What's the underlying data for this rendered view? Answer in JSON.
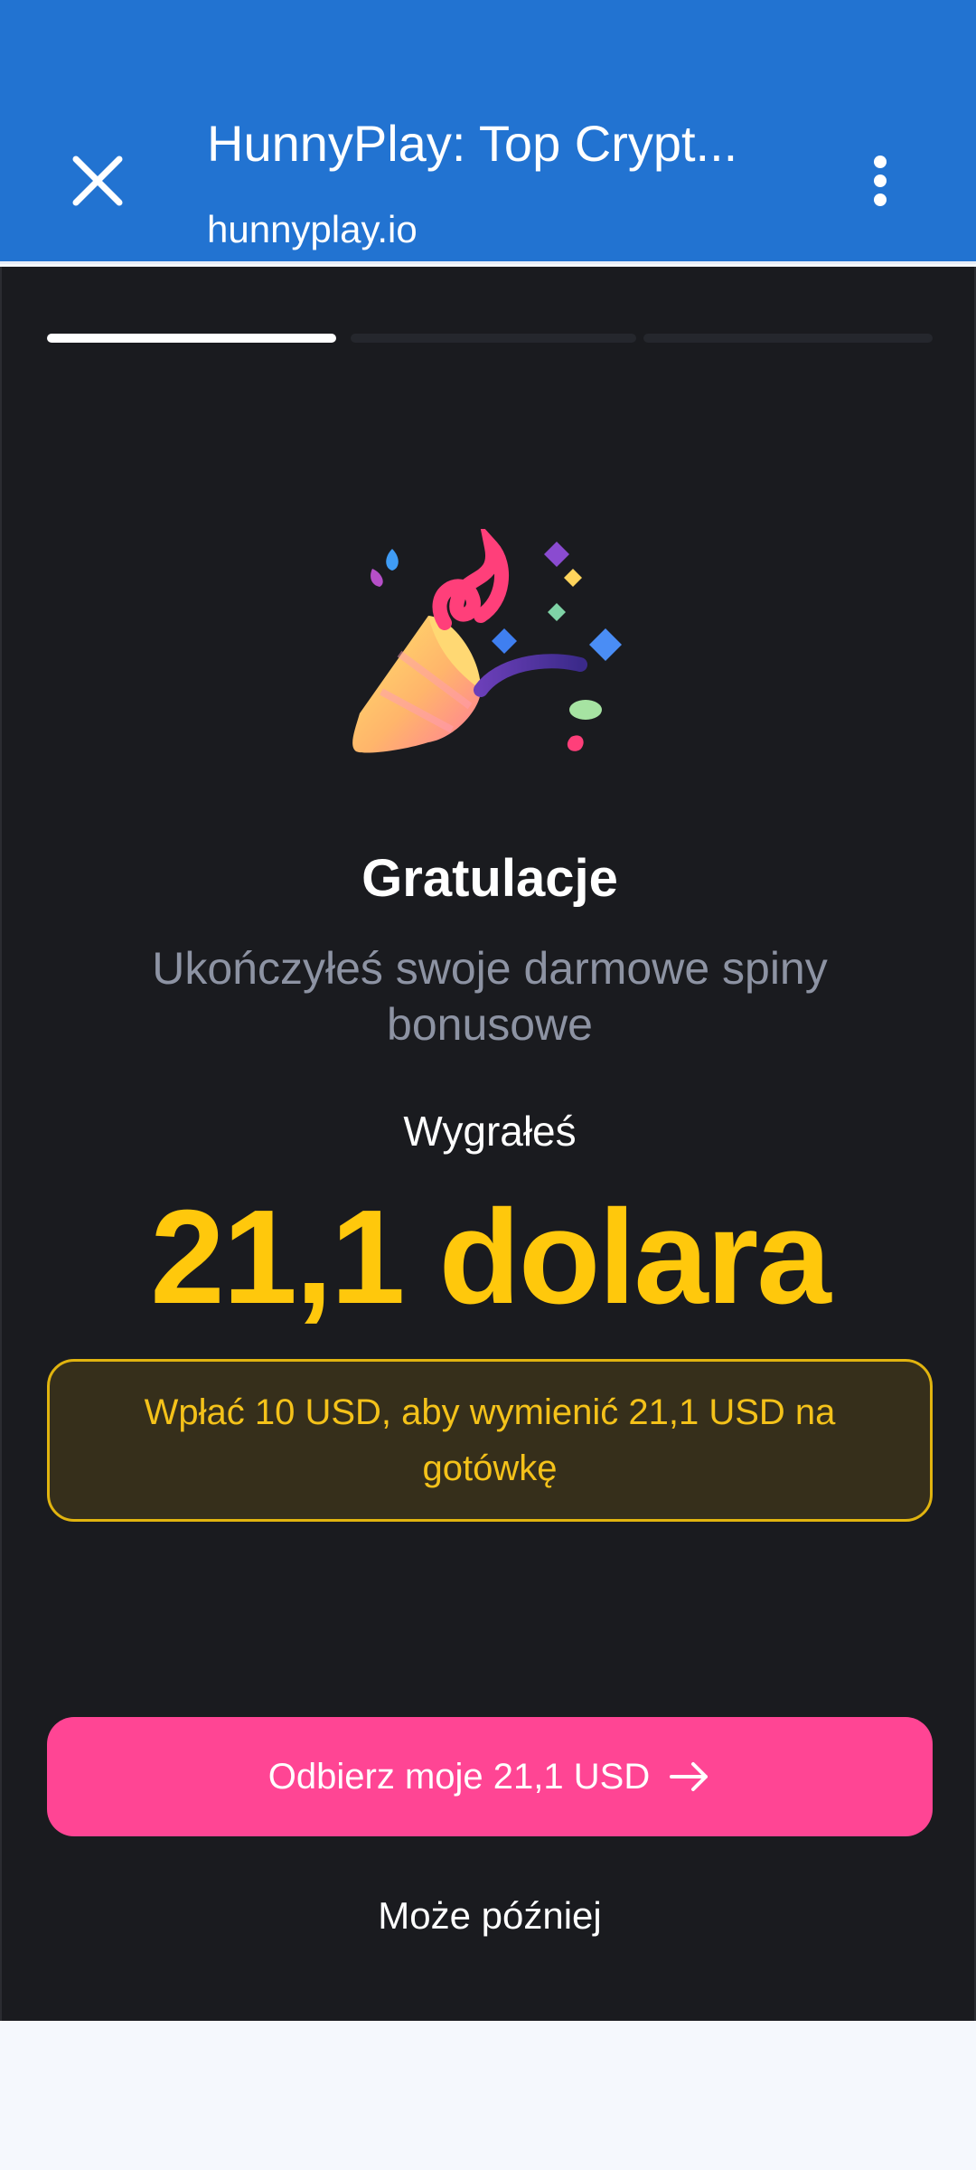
{
  "browser": {
    "title": "HunnyPlay: Top Crypt...",
    "url": "hunnyplay.io",
    "close_icon": "close-icon",
    "menu_icon": "more-vert-icon",
    "bar_color": "#2273d1"
  },
  "modal": {
    "step": {
      "current": 1,
      "total": 3
    },
    "icon": "party-popper-icon",
    "heading": "Gratulacje",
    "subtitle": "Ukończyłeś swoje darmowe spiny bonusowe",
    "won_label": "Wygrałeś",
    "amount": "21,1 dolara",
    "notice": "Wpłać 10 USD, aby wymienić 21,1 USD na gotówkę",
    "claim_button": "Odbierz moje 21,1 USD",
    "claim_icon": "arrow-right-icon",
    "later_link": "Może później",
    "colors": {
      "accent_yellow": "#ffc80c",
      "button_pink": "#ff4594",
      "panel_bg": "#1a1b1f"
    }
  }
}
